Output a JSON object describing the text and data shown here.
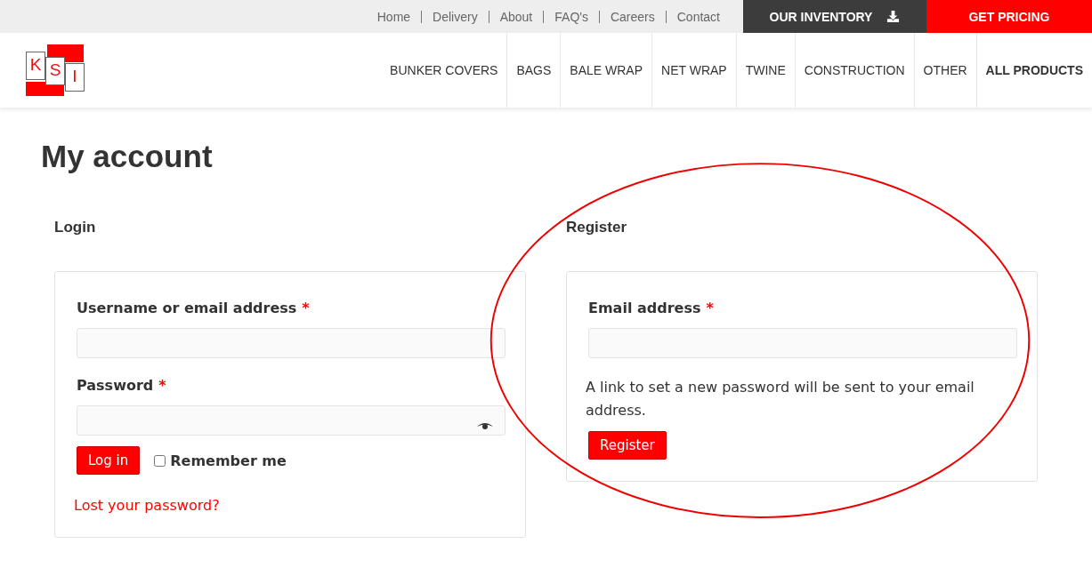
{
  "top_links": [
    "Home",
    "Delivery",
    "About",
    "FAQ's",
    "Careers",
    "Contact"
  ],
  "inventory_button": "OUR INVENTORY",
  "pricing_button": "GET PRICING",
  "logo": {
    "letters": [
      "K",
      "S",
      "I"
    ]
  },
  "nav": [
    {
      "label": "BUNKER COVERS",
      "selected": false
    },
    {
      "label": "BAGS",
      "selected": false
    },
    {
      "label": "BALE WRAP",
      "selected": false
    },
    {
      "label": "NET WRAP",
      "selected": false
    },
    {
      "label": "TWINE",
      "selected": false
    },
    {
      "label": "CONSTRUCTION",
      "selected": false
    },
    {
      "label": "OTHER",
      "selected": false
    },
    {
      "label": "ALL PRODUCTS",
      "selected": true
    }
  ],
  "page_title": "My account",
  "login": {
    "heading": "Login",
    "fields": [
      {
        "label": "Username or email address",
        "required": "*",
        "kind": "text"
      },
      {
        "label": "Password",
        "required": "*",
        "kind": "password"
      }
    ],
    "button": "Log in",
    "remember": {
      "label": "Remember me",
      "checked": false
    },
    "lost_link": "Lost your password?"
  },
  "register": {
    "heading": "Register",
    "fields": [
      {
        "label": "Email address",
        "required": "*",
        "kind": "text"
      }
    ],
    "note": "A link to set a new password will be sent to your email address.",
    "button": "Register"
  }
}
